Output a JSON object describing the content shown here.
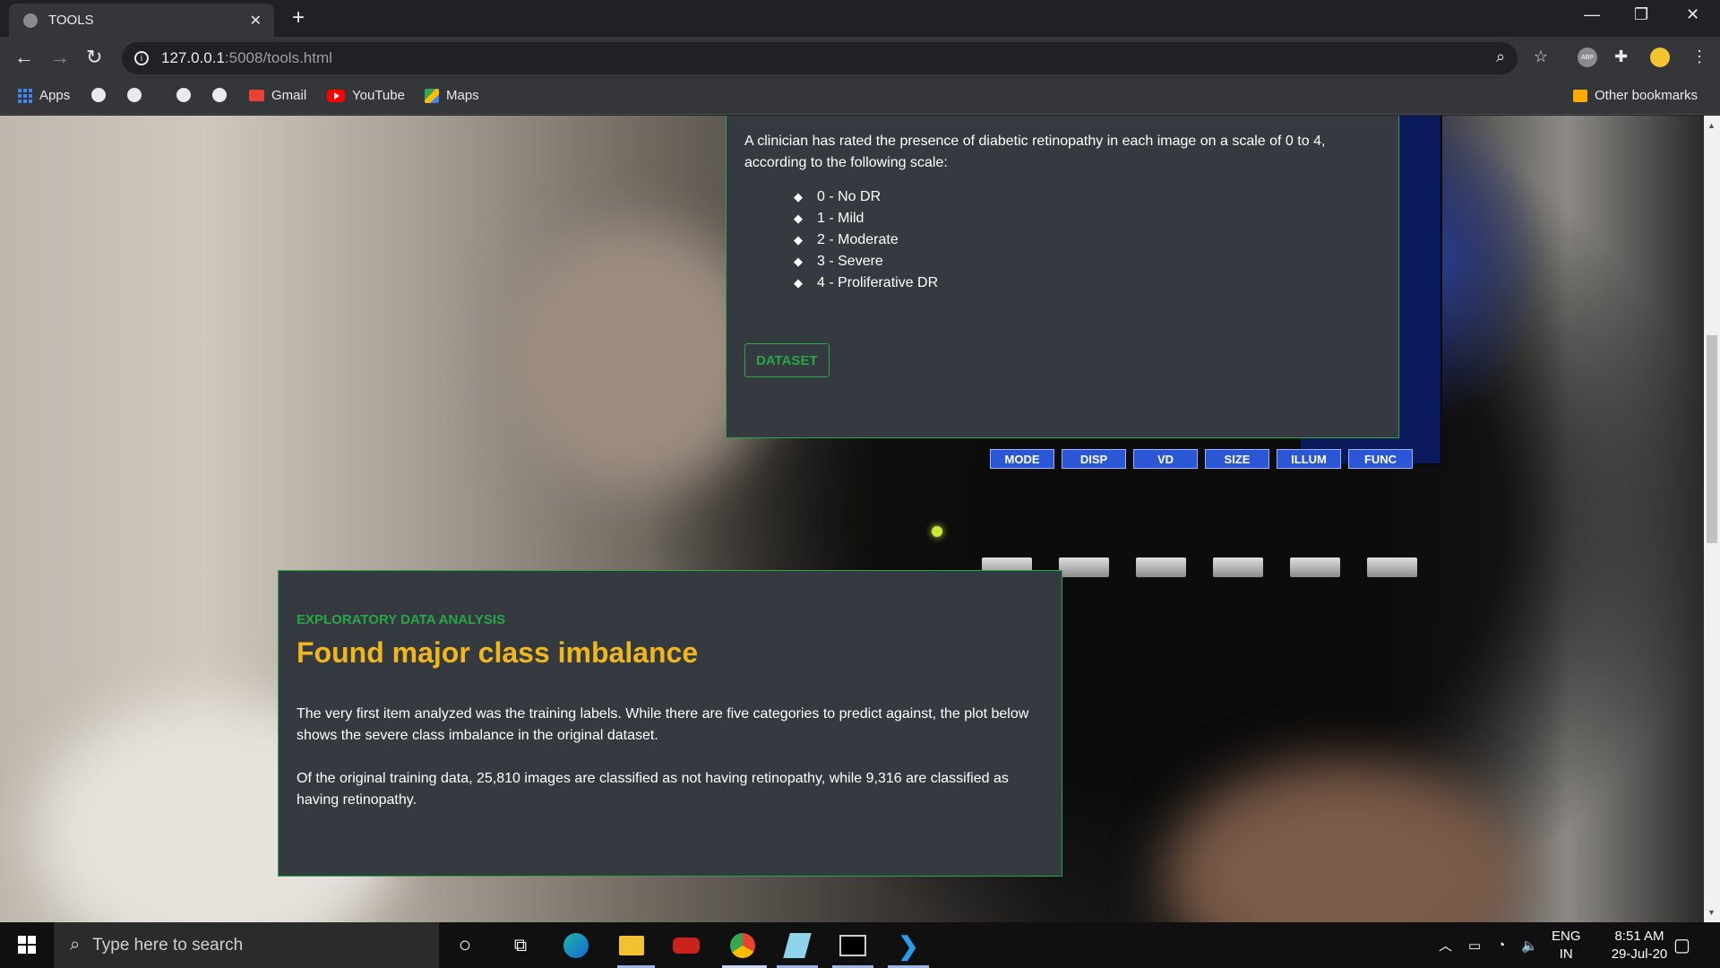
{
  "browser": {
    "tab_title": "TOOLS",
    "tab_close": "✕",
    "new_tab": "+",
    "url_host": "127.0.0.1",
    "url_path": ":5008/tools.html",
    "window_minimize": "—",
    "window_restore": "❐",
    "window_close": "✕",
    "ext_abp": "ABP"
  },
  "bookmarks": {
    "apps": "Apps",
    "gmail": "Gmail",
    "youtube": "YouTube",
    "maps": "Maps",
    "other": "Other bookmarks"
  },
  "device": {
    "buttons": [
      "MODE",
      "DISP",
      "VD",
      "SIZE",
      "ILLUM",
      "FUNC"
    ]
  },
  "card1": {
    "intro": "A clinician has rated the presence of diabetic retinopathy in each image on a scale of 0 to 4, according to the following scale:",
    "scale": [
      "0 - No DR",
      "1 - Mild",
      "2 - Moderate",
      "3 - Severe",
      "4 - Proliferative DR"
    ],
    "button": "DATASET"
  },
  "card2": {
    "kicker": "EXPLORATORY DATA ANALYSIS",
    "title": "Found major class imbalance",
    "para1": "The very first item analyzed was the training labels. While there are five categories to predict against, the plot below shows the severe class imbalance in the original dataset.",
    "para2": "Of the original training data, 25,810 images are classified as not having retinopathy, while 9,316 are classified as having retinopathy."
  },
  "taskbar": {
    "search_placeholder": "Type here to search",
    "lang_top": "ENG",
    "lang_bottom": "IN",
    "time": "8:51 AM",
    "date": "29-Jul-20"
  }
}
